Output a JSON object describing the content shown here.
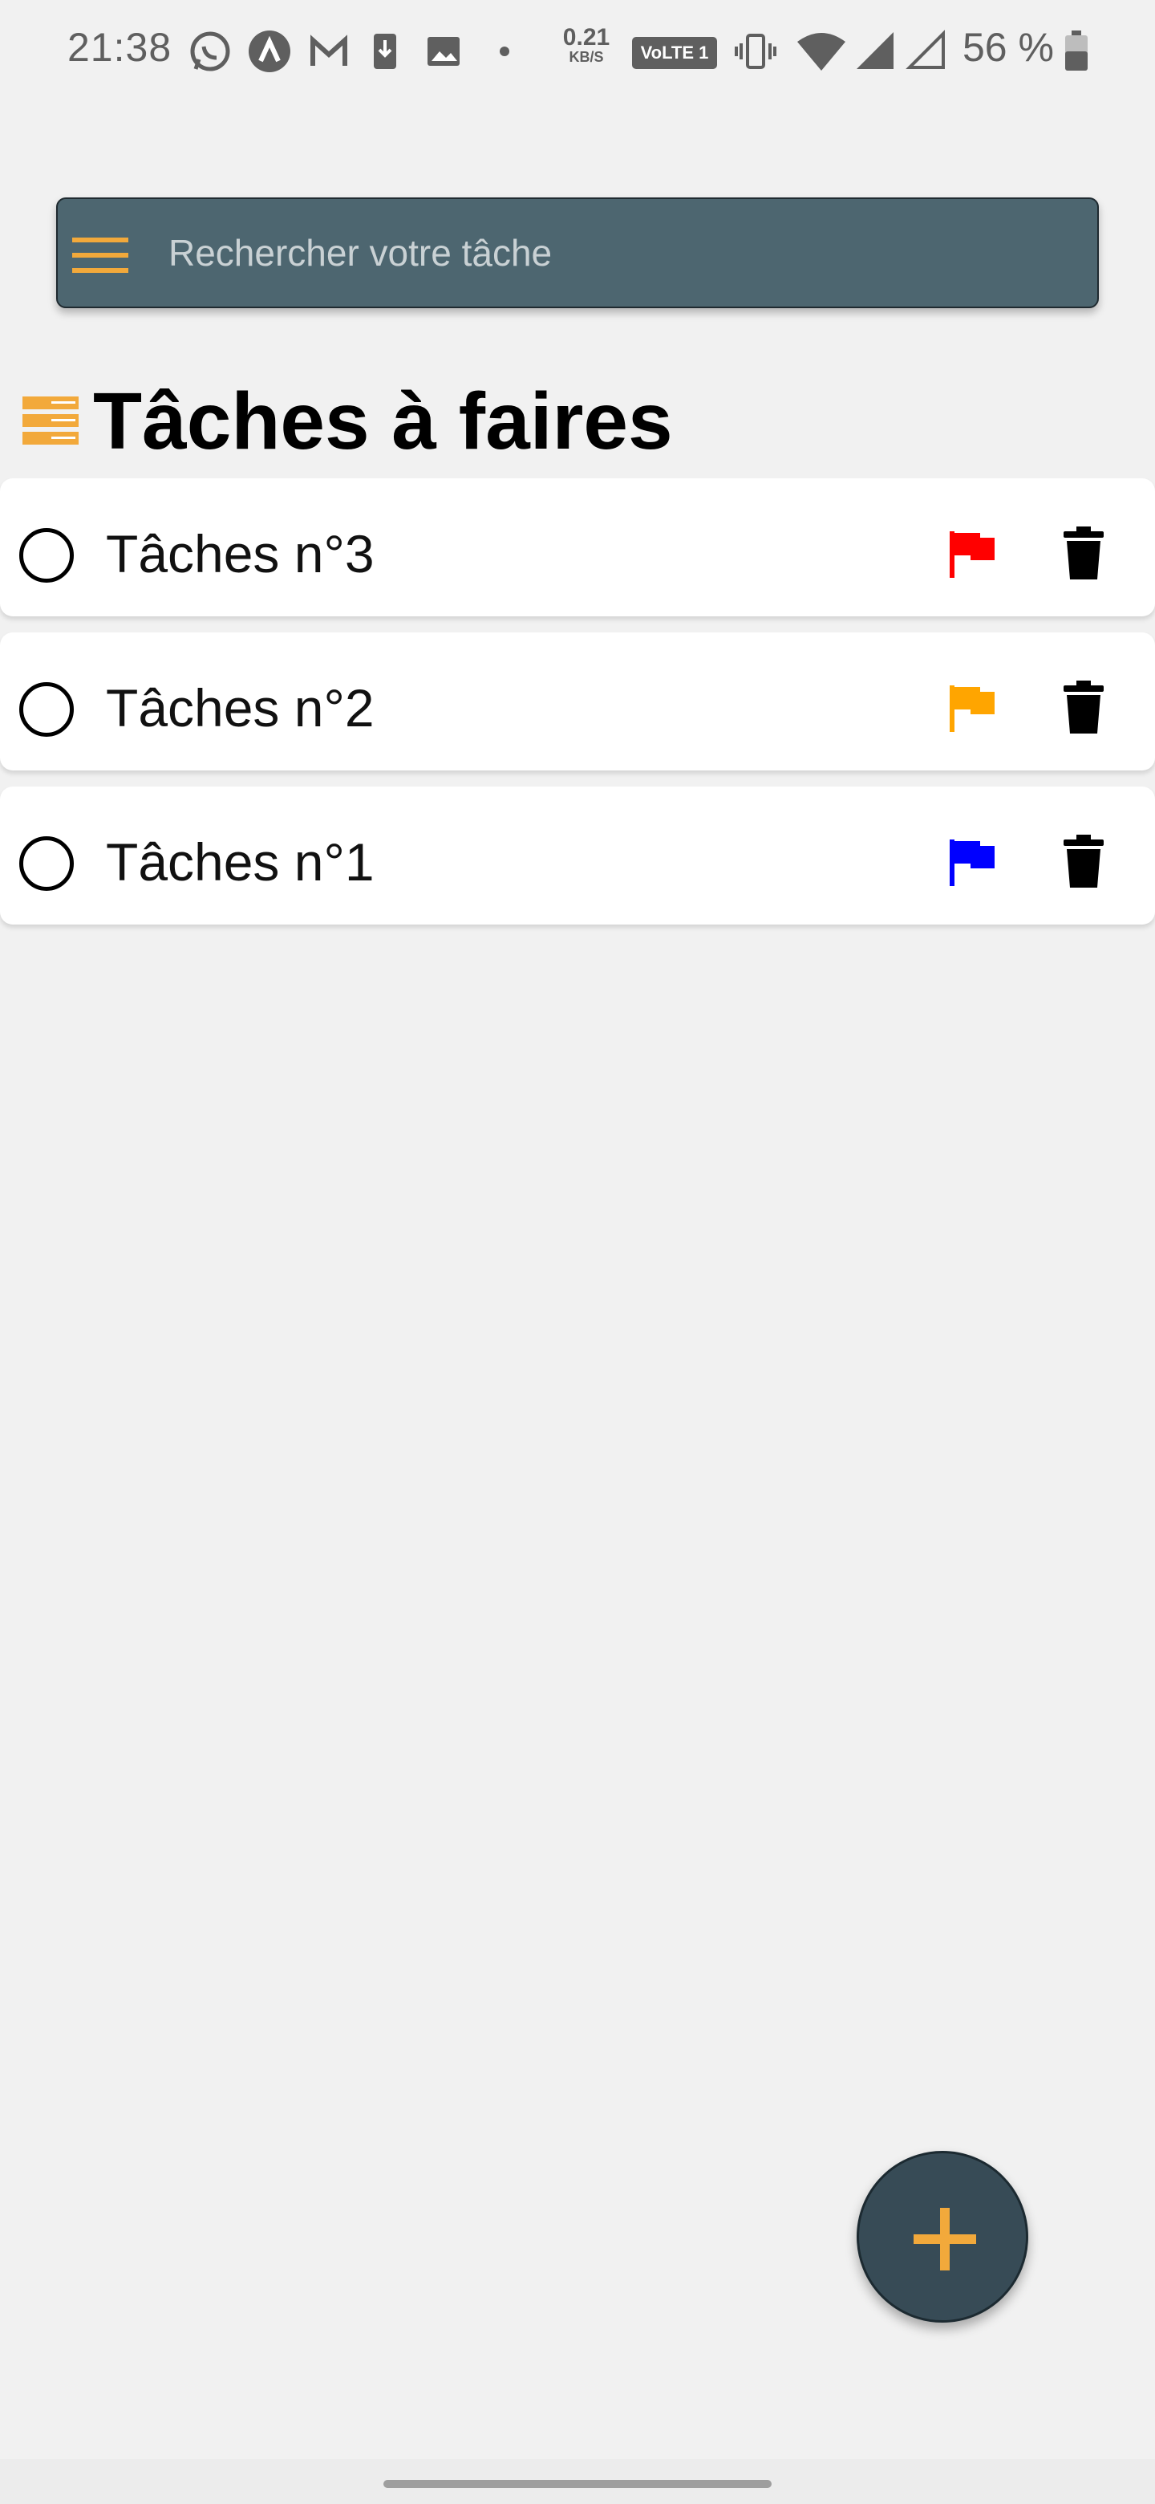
{
  "status_bar": {
    "time": "21:38",
    "net_speed_value": "0.21",
    "net_speed_unit": "KB/S",
    "volte_label": "VoLTE 1",
    "battery_percent": "56 %",
    "icons": [
      "whatsapp-icon",
      "app-icon",
      "gmail-icon",
      "download-icon",
      "image-icon",
      "dot-icon",
      "vibrate-icon",
      "wifi-icon",
      "signal-icon",
      "signal-empty-icon",
      "battery-icon"
    ]
  },
  "search": {
    "placeholder": "Rechercher votre tâche",
    "background": "#4d6670",
    "accent": "#f2a93b"
  },
  "page": {
    "title": "Tâches à faires"
  },
  "tasks": [
    {
      "label": "Tâches n°3",
      "flag_color": "#ff0000"
    },
    {
      "label": "Tâches n°2",
      "flag_color": "#ffa500"
    },
    {
      "label": "Tâches n°1",
      "flag_color": "#0000ff"
    }
  ],
  "fab": {
    "icon": "plus-icon",
    "color": "#f2a93b",
    "background": "#374b56"
  }
}
